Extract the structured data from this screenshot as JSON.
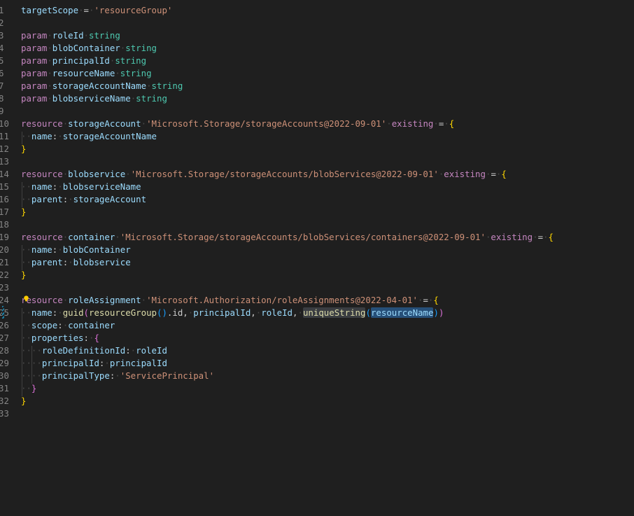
{
  "editor": {
    "language": "bicep",
    "lines": [
      {
        "num": "1",
        "tokens": [
          [
            "id",
            "targetScope"
          ],
          [
            "ws",
            "·"
          ],
          [
            "pun",
            "="
          ],
          [
            "ws",
            "·"
          ],
          [
            "str",
            "'resourceGroup'"
          ]
        ]
      },
      {
        "num": "2",
        "tokens": []
      },
      {
        "num": "3",
        "tokens": [
          [
            "kw",
            "param"
          ],
          [
            "ws",
            "·"
          ],
          [
            "id",
            "roleId"
          ],
          [
            "ws",
            "·"
          ],
          [
            "ty",
            "string"
          ]
        ]
      },
      {
        "num": "4",
        "tokens": [
          [
            "kw",
            "param"
          ],
          [
            "ws",
            "·"
          ],
          [
            "id",
            "blobContainer"
          ],
          [
            "ws",
            "·"
          ],
          [
            "ty",
            "string"
          ]
        ]
      },
      {
        "num": "5",
        "tokens": [
          [
            "kw",
            "param"
          ],
          [
            "ws",
            "·"
          ],
          [
            "id",
            "principalId"
          ],
          [
            "ws",
            "·"
          ],
          [
            "ty",
            "string"
          ]
        ]
      },
      {
        "num": "6",
        "tokens": [
          [
            "kw",
            "param"
          ],
          [
            "ws",
            "·"
          ],
          [
            "id",
            "resourceName"
          ],
          [
            "ws",
            "·"
          ],
          [
            "ty",
            "string"
          ]
        ]
      },
      {
        "num": "7",
        "tokens": [
          [
            "kw",
            "param"
          ],
          [
            "ws",
            "·"
          ],
          [
            "id",
            "storageAccountName"
          ],
          [
            "ws",
            "·"
          ],
          [
            "ty",
            "string"
          ]
        ]
      },
      {
        "num": "8",
        "tokens": [
          [
            "kw",
            "param"
          ],
          [
            "ws",
            "·"
          ],
          [
            "id",
            "blobserviceName"
          ],
          [
            "ws",
            "·"
          ],
          [
            "ty",
            "string"
          ]
        ]
      },
      {
        "num": "9",
        "tokens": []
      },
      {
        "num": "10",
        "tokens": [
          [
            "kw",
            "resource"
          ],
          [
            "ws",
            "·"
          ],
          [
            "id",
            "storageAccount"
          ],
          [
            "ws",
            "·"
          ],
          [
            "str",
            "'Microsoft.Storage/storageAccounts@2022-09-01'"
          ],
          [
            "ws",
            "·"
          ],
          [
            "kw",
            "existing"
          ],
          [
            "ws",
            "·"
          ],
          [
            "pun",
            "="
          ],
          [
            "ws",
            "·"
          ],
          [
            "br1",
            "{"
          ]
        ]
      },
      {
        "num": "11",
        "tokens": [
          [
            "ws",
            "··"
          ],
          [
            "id",
            "name"
          ],
          [
            "pun",
            ":"
          ],
          [
            "ws",
            "·"
          ],
          [
            "id",
            "storageAccountName"
          ]
        ]
      },
      {
        "num": "12",
        "tokens": [
          [
            "br1",
            "}"
          ]
        ]
      },
      {
        "num": "13",
        "tokens": []
      },
      {
        "num": "14",
        "tokens": [
          [
            "kw",
            "resource"
          ],
          [
            "ws",
            "·"
          ],
          [
            "id",
            "blobservice"
          ],
          [
            "ws",
            "·"
          ],
          [
            "str",
            "'Microsoft.Storage/storageAccounts/blobServices@2022-09-01'"
          ],
          [
            "ws",
            "·"
          ],
          [
            "kw",
            "existing"
          ],
          [
            "ws",
            "·"
          ],
          [
            "pun",
            "="
          ],
          [
            "ws",
            "·"
          ],
          [
            "br1",
            "{"
          ]
        ]
      },
      {
        "num": "15",
        "tokens": [
          [
            "ws",
            "··"
          ],
          [
            "id",
            "name"
          ],
          [
            "pun",
            ":"
          ],
          [
            "ws",
            "·"
          ],
          [
            "id",
            "blobserviceName"
          ]
        ]
      },
      {
        "num": "16",
        "tokens": [
          [
            "ws",
            "··"
          ],
          [
            "id",
            "parent"
          ],
          [
            "pun",
            ":"
          ],
          [
            "ws",
            "·"
          ],
          [
            "id",
            "storageAccount"
          ]
        ]
      },
      {
        "num": "17",
        "tokens": [
          [
            "br1",
            "}"
          ]
        ]
      },
      {
        "num": "18",
        "tokens": []
      },
      {
        "num": "19",
        "tokens": [
          [
            "kw",
            "resource"
          ],
          [
            "ws",
            "·"
          ],
          [
            "id",
            "container"
          ],
          [
            "ws",
            "·"
          ],
          [
            "str",
            "'Microsoft.Storage/storageAccounts/blobServices/containers@2022-09-01'"
          ],
          [
            "ws",
            "·"
          ],
          [
            "kw",
            "existing"
          ],
          [
            "ws",
            "·"
          ],
          [
            "pun",
            "="
          ],
          [
            "ws",
            "·"
          ],
          [
            "br1",
            "{"
          ]
        ]
      },
      {
        "num": "20",
        "tokens": [
          [
            "ws",
            "··"
          ],
          [
            "id",
            "name"
          ],
          [
            "pun",
            ":"
          ],
          [
            "ws",
            "·"
          ],
          [
            "id",
            "blobContainer"
          ]
        ]
      },
      {
        "num": "21",
        "tokens": [
          [
            "ws",
            "··"
          ],
          [
            "id",
            "parent"
          ],
          [
            "pun",
            ":"
          ],
          [
            "ws",
            "·"
          ],
          [
            "id",
            "blobservice"
          ]
        ]
      },
      {
        "num": "22",
        "tokens": [
          [
            "br1",
            "}"
          ]
        ]
      },
      {
        "num": "23",
        "tokens": []
      },
      {
        "num": "24",
        "tokens": [
          [
            "kw",
            "resource"
          ],
          [
            "ws",
            "·"
          ],
          [
            "id",
            "roleAssignment"
          ],
          [
            "ws",
            "·"
          ],
          [
            "str",
            "'Microsoft.Authorization/roleAssignments@2022-04-01'"
          ],
          [
            "ws",
            "·"
          ],
          [
            "pun",
            "="
          ],
          [
            "ws",
            "·"
          ],
          [
            "br1",
            "{"
          ]
        ]
      },
      {
        "num": "25",
        "tokens": [
          [
            "ws",
            "··"
          ],
          [
            "id",
            "name"
          ],
          [
            "pun",
            ":"
          ],
          [
            "ws",
            "·"
          ],
          [
            "fn",
            "guid"
          ],
          [
            "br2",
            "("
          ],
          [
            "fn",
            "resourceGroup"
          ],
          [
            "br3",
            "()"
          ],
          [
            "pun",
            ".id,"
          ],
          [
            "ws",
            "·"
          ],
          [
            "id",
            "principalId"
          ],
          [
            "pun",
            ","
          ],
          [
            "ws",
            "·"
          ],
          [
            "id",
            "roleId"
          ],
          [
            "pun",
            ","
          ],
          [
            "ws",
            "·"
          ],
          [
            "fn hl-word",
            "uniqueString"
          ],
          [
            "br3",
            "("
          ],
          [
            "id hl-sel",
            "resourceName"
          ],
          [
            "br3",
            ")"
          ],
          [
            "br2",
            ")"
          ]
        ]
      },
      {
        "num": "26",
        "tokens": [
          [
            "ws",
            "··"
          ],
          [
            "id",
            "scope"
          ],
          [
            "pun",
            ":"
          ],
          [
            "ws",
            "·"
          ],
          [
            "id",
            "container"
          ]
        ]
      },
      {
        "num": "27",
        "tokens": [
          [
            "ws",
            "··"
          ],
          [
            "id",
            "properties"
          ],
          [
            "pun",
            ":"
          ],
          [
            "ws",
            "·"
          ],
          [
            "br2",
            "{"
          ]
        ]
      },
      {
        "num": "28",
        "tokens": [
          [
            "ws",
            "····"
          ],
          [
            "id",
            "roleDefinitionId"
          ],
          [
            "pun",
            ":"
          ],
          [
            "ws",
            "·"
          ],
          [
            "id",
            "roleId"
          ]
        ]
      },
      {
        "num": "29",
        "tokens": [
          [
            "ws",
            "····"
          ],
          [
            "id",
            "principalId"
          ],
          [
            "pun",
            ":"
          ],
          [
            "ws",
            "·"
          ],
          [
            "id",
            "principalId"
          ]
        ]
      },
      {
        "num": "30",
        "tokens": [
          [
            "ws",
            "····"
          ],
          [
            "id",
            "principalType"
          ],
          [
            "pun",
            ":"
          ],
          [
            "ws",
            "·"
          ],
          [
            "str",
            "'ServicePrincipal'"
          ]
        ]
      },
      {
        "num": "31",
        "tokens": [
          [
            "ws",
            "··"
          ],
          [
            "br2",
            "}"
          ]
        ]
      },
      {
        "num": "32",
        "tokens": [
          [
            "br1",
            "}"
          ]
        ]
      },
      {
        "num": "33",
        "tokens": []
      }
    ]
  },
  "gutter": {
    "lightbulb_icon": "lightbulb-icon",
    "modified_marker": "diff-modified-marker"
  },
  "colors": {
    "background": "#1f1f1f",
    "keyword": "#c586c0",
    "identifier": "#9cdcfe",
    "type": "#4ec9b0",
    "string": "#ce9178",
    "function": "#dcdcaa",
    "bracket_level1": "#ffd700",
    "bracket_level2": "#da70d6",
    "bracket_level3": "#179fff",
    "line_number": "#858585"
  }
}
